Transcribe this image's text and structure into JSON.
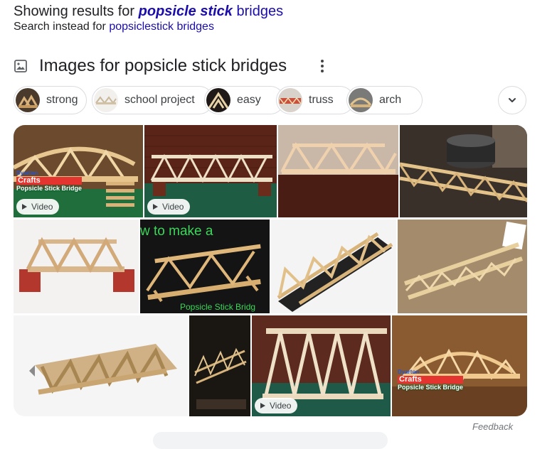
{
  "correction": {
    "prefix": "Showing results for",
    "query_corrected": "popsicle stick",
    "query_rest": "bridges"
  },
  "search_instead": {
    "prefix": "Search instead for",
    "link": "popsiclestick bridges"
  },
  "images_section": {
    "title": "Images for popsicle stick bridges",
    "icon": "image-icon",
    "more_icon": "more-vert-icon"
  },
  "chips": [
    {
      "label": "strong"
    },
    {
      "label": "school project"
    },
    {
      "label": "easy"
    },
    {
      "label": "truss"
    },
    {
      "label": "arch"
    }
  ],
  "expand_icon": "chevron-down-icon",
  "tiles": {
    "video_label": "Video",
    "brand_line1": "Dyarton",
    "brand_line2": "Crafts",
    "brand_line3": "Popsicle Stick Bridge",
    "overlay_how_to": "w to make a",
    "overlay_popsicle": "Popsicle Stick Bridg"
  },
  "feedback": "Feedback"
}
